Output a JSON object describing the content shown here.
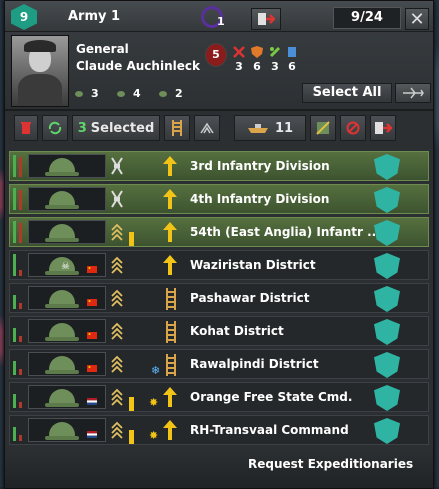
{
  "army": {
    "badge_number": "9",
    "name": "Army 1",
    "command_value": "1",
    "division_count": "9/24"
  },
  "icons": {
    "close": "✕"
  },
  "general": {
    "title": "General",
    "name": "Claude Auchinleck",
    "skill_level": "5",
    "attack": "3",
    "defense": "6",
    "planning": "3",
    "logistics": "6"
  },
  "traits": [
    "3",
    "4",
    "2"
  ],
  "labels": {
    "select_all": "Select All",
    "request_expeditionaries": "Request Expeditionaries"
  },
  "toolbar": {
    "selected_count": "3",
    "selected_label": "Selected",
    "transport_count": "11"
  },
  "colors": {
    "selected_row": "#4f6a3a",
    "accent_teal": "#2fb4a4",
    "strength_green": "#4caf50",
    "org_red": "#b03a2a",
    "rank_yellow": "#f2c417"
  },
  "divisions": [
    {
      "name": "3rd Infantry Division",
      "selected": true,
      "flag": "",
      "marker": "",
      "order_icon": "arrow-up",
      "badge": "infantry-symbol-icon",
      "extra": ""
    },
    {
      "name": "4th Infantry Division",
      "selected": true,
      "flag": "",
      "marker": "",
      "order_icon": "arrow-up",
      "badge": "infantry-symbol-icon",
      "extra": ""
    },
    {
      "name": "54th (East Anglia) Infantr ...",
      "selected": true,
      "flag": "",
      "marker": "",
      "order_icon": "arrow-up",
      "badge": "rank-chevron-icon",
      "extra": "rank-bar"
    },
    {
      "name": "Waziristan District",
      "selected": false,
      "flag": "china",
      "marker": "skull",
      "order_icon": "arrow-up",
      "badge": "rank-chevron-icon",
      "extra": ""
    },
    {
      "name": "Pashawar District",
      "selected": false,
      "flag": "china",
      "marker": "",
      "order_icon": "railway",
      "badge": "rank-chevron-icon",
      "extra": ""
    },
    {
      "name": "Kohat District",
      "selected": false,
      "flag": "china",
      "marker": "",
      "order_icon": "railway",
      "badge": "rank-chevron-icon",
      "extra": ""
    },
    {
      "name": "Rawalpindi District",
      "selected": false,
      "flag": "china",
      "marker": "",
      "order_icon": "railway",
      "badge": "rank-chevron-icon",
      "extra": "snow"
    },
    {
      "name": "Orange Free State Cmd.",
      "selected": false,
      "flag": "netherlands",
      "marker": "",
      "order_icon": "arrow-up",
      "badge": "rank-chevron-icon",
      "extra": "sun-rank-bar"
    },
    {
      "name": "RH-Transvaal Command",
      "selected": false,
      "flag": "netherlands",
      "marker": "",
      "order_icon": "arrow-up",
      "badge": "rank-chevron-icon",
      "extra": "sun-rank-bar"
    }
  ]
}
